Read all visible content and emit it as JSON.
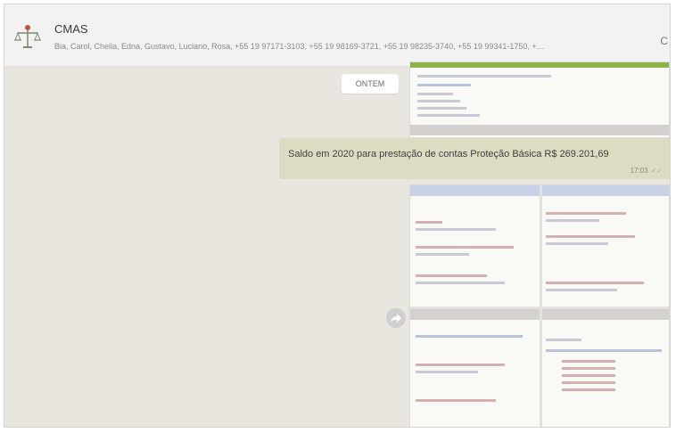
{
  "header": {
    "group_name": "CMAS",
    "members": "Bia, Carol, Cheila, Edna, Gustavo, Luciano, Rosa, +55 19 97171-3103, +55 19 98169-3721, +55 19 98235-3740, +55 19 99341-1750, +…",
    "avatar_icon": "scales-of-justice-icon",
    "menu_glyph": "C"
  },
  "chat": {
    "date_divider": "ONTEM",
    "message": {
      "text": "Saldo em 2020 para prestação de contas Proteção Básica R$ 269.201,69",
      "time": "17:03",
      "ticks": "✓✓"
    },
    "forward_icon": "forward-arrow-icon"
  },
  "colors": {
    "chat_background": "#e9e6df",
    "outgoing_bubble": "#dcdcc2",
    "header_background": "#f2f2f2"
  }
}
